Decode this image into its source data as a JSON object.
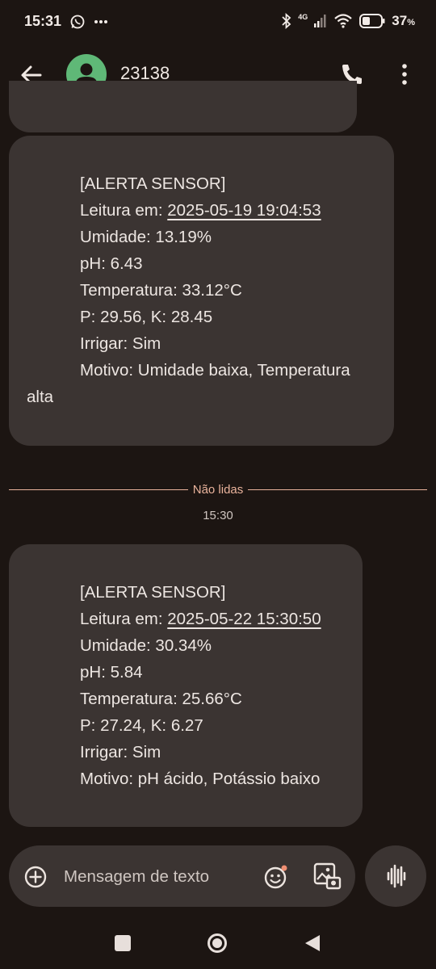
{
  "status_bar": {
    "time": "15:31",
    "signal_label": "4G",
    "battery_percent": "37",
    "battery_suffix": "%"
  },
  "app_bar": {
    "contact_name": "23138",
    "avatar_color": "#5fb877"
  },
  "messages": [
    {
      "lines": [
        "[ALERTA SENSOR]",
        {
          "prefix": "Leitura em: ",
          "link": "2025-05-19 19:04:53"
        },
        "Umidade: 13.19%",
        "pH: 6.43",
        "Temperatura: 33.12°C",
        "P: 29.56, K: 28.45",
        "Irrigar: Sim",
        "Motivo: Umidade baixa, Temperatura",
        "alta"
      ]
    },
    {
      "lines": [
        "[ALERTA SENSOR]",
        {
          "prefix": "Leitura em: ",
          "link": "2025-05-22 15:30:50"
        },
        "Umidade: 30.34%",
        "pH: 5.84",
        "Temperatura: 25.66°C",
        "P: 27.24, K: 6.27",
        "Irrigar: Sim",
        "Motivo: pH ácido, Potássio baixo"
      ]
    }
  ],
  "divider": {
    "label": "Não lidas",
    "time": "15:30"
  },
  "compose": {
    "placeholder": "Mensagem de texto"
  },
  "colors": {
    "background": "#1c1512",
    "bubble": "#3b3432",
    "divider_accent": "#e9b39c"
  }
}
